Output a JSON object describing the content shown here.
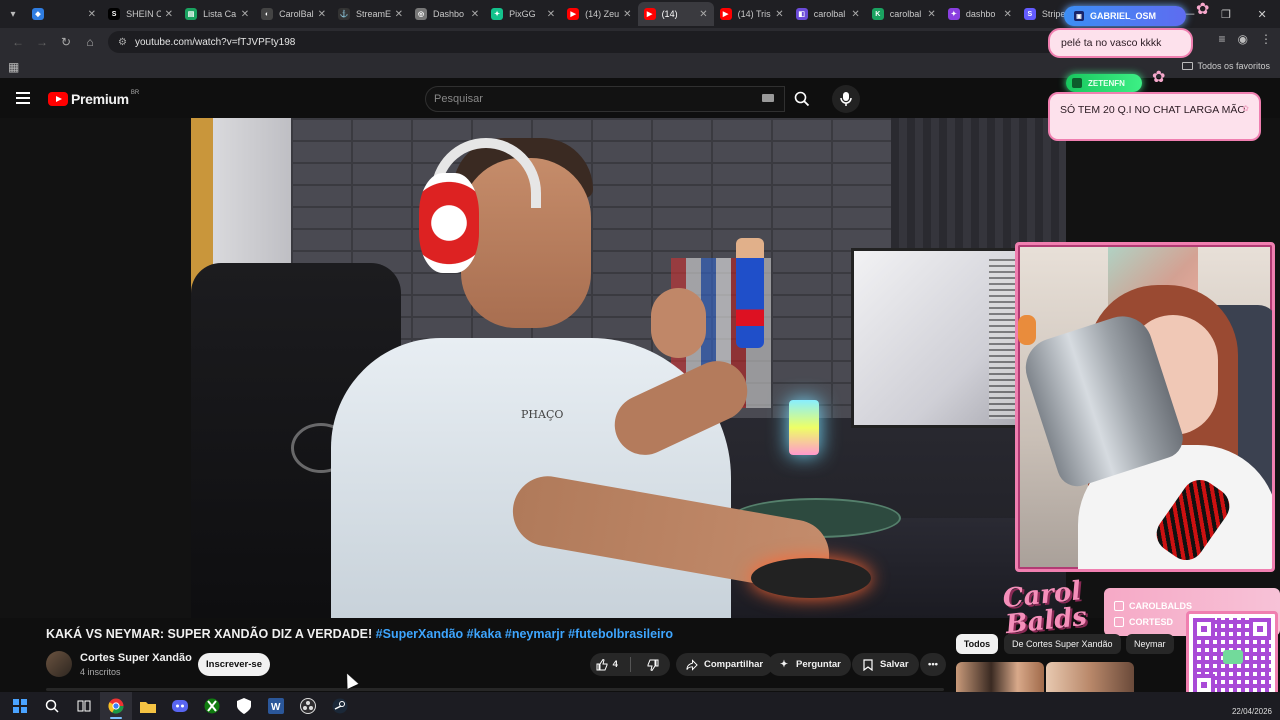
{
  "browser": {
    "tabs": [
      {
        "label": "",
        "color": "#2f7de1",
        "glyph": "◆"
      },
      {
        "label": "SHEIN C",
        "color": "#000000",
        "glyph": "S"
      },
      {
        "label": "Lista Ca",
        "color": "#1aa260",
        "glyph": "▤"
      },
      {
        "label": "CarolBal",
        "color": "#444444",
        "glyph": "◐"
      },
      {
        "label": "StreamE",
        "color": "#333333",
        "glyph": "⚓"
      },
      {
        "label": "Dashbo",
        "color": "#777777",
        "glyph": "◎"
      },
      {
        "label": "PixGG",
        "color": "#14c28c",
        "glyph": "✦"
      },
      {
        "label": "(14) Zeu",
        "color": "#ff0000",
        "glyph": "▶"
      },
      {
        "label": "(14)",
        "color": "#ff0000",
        "glyph": "▶",
        "active": true
      },
      {
        "label": "(14) Tris",
        "color": "#ff0000",
        "glyph": "▶"
      },
      {
        "label": "carolbal",
        "color": "#6b4bd8",
        "glyph": "◧"
      },
      {
        "label": "carolbal",
        "color": "#1aa260",
        "glyph": "K"
      },
      {
        "label": "dashbo",
        "color": "#8a3fe0",
        "glyph": "✦"
      },
      {
        "label": "Stripe D",
        "color": "#635bff",
        "glyph": "S"
      },
      {
        "label": "",
        "color": "#2f7de1",
        "glyph": ""
      }
    ],
    "url": "youtube.com/watch?v=fTJVPFty198",
    "favorites_label": "Todos os favoritos"
  },
  "youtube": {
    "brand": "Premium",
    "region": "BR",
    "search_placeholder": "Pesquisar",
    "video_title_main": "KAKÁ VS NEYMAR: SUPER XANDÃO DIZ A VERDADE! ",
    "video_tags": "#SuperXandão #kaka #neymarjr #futebolbrasileiro",
    "shirt_text": "PHAÇO",
    "channel_name": "Cortes Super Xandão",
    "channel_subs": "4 inscritos",
    "subscribe_label": "Inscrever-se",
    "like_count": "4",
    "share_label": "Compartilhar",
    "ask_label": "Perguntar",
    "save_label": "Salvar",
    "chips": [
      "Todos",
      "De Cortes Super Xandão",
      "Neymar"
    ]
  },
  "overlay": {
    "chat": [
      {
        "user": "GABRIEL_OSM",
        "message": "pelé ta no vasco kkkk"
      },
      {
        "user": "ZETENFN",
        "message": "SÓ TEM 20 Q.I NO CHAT LARGA MÃO"
      }
    ],
    "streamer_brand": "Carol Balds",
    "socials": [
      "CAROLBALDS",
      "CORTESD"
    ]
  },
  "taskbar": {
    "date": "22/04/2026"
  }
}
